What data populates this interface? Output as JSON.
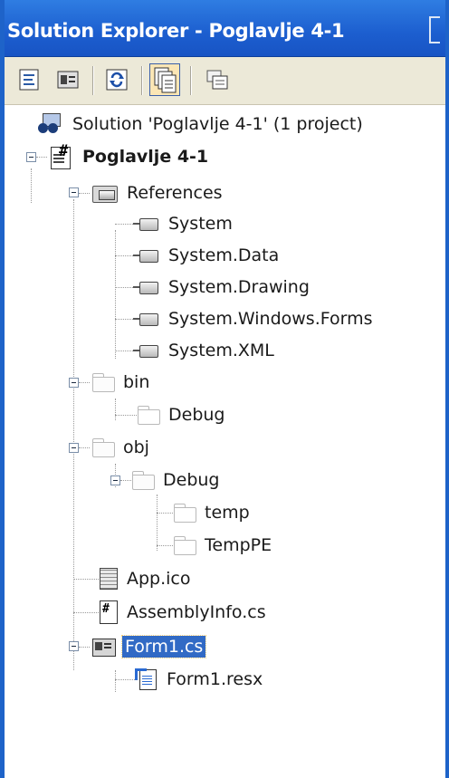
{
  "window": {
    "title": "Solution Explorer - Poglavlje 4-1"
  },
  "toolbar": {
    "buttons": [
      {
        "name": "view-code-button",
        "icon": "view-code-icon"
      },
      {
        "name": "view-designer-button",
        "icon": "view-designer-icon"
      },
      {
        "name": "refresh-button",
        "icon": "refresh-icon"
      },
      {
        "name": "show-all-files-button",
        "icon": "show-all-files-icon",
        "pressed": true
      },
      {
        "name": "properties-button",
        "icon": "properties-icon"
      }
    ]
  },
  "tree": {
    "solution": "Solution 'Poglavlje 4-1' (1 project)",
    "project": "Poglavlje 4-1",
    "references": {
      "label": "References",
      "items": [
        "System",
        "System.Data",
        "System.Drawing",
        "System.Windows.Forms",
        "System.XML"
      ]
    },
    "bin": {
      "label": "bin",
      "children": [
        "Debug"
      ]
    },
    "obj": {
      "label": "obj",
      "debug": "Debug",
      "children": [
        "temp",
        "TempPE"
      ]
    },
    "files": {
      "app_ico": "App.ico",
      "assembly_info": "AssemblyInfo.cs"
    },
    "form": {
      "label": "Form1.cs",
      "selected": true,
      "children": [
        "Form1.resx"
      ]
    }
  },
  "colors": {
    "title_bar": "#1c5ecf",
    "selection": "#316ac5",
    "toolbar": "#ece9d8"
  }
}
